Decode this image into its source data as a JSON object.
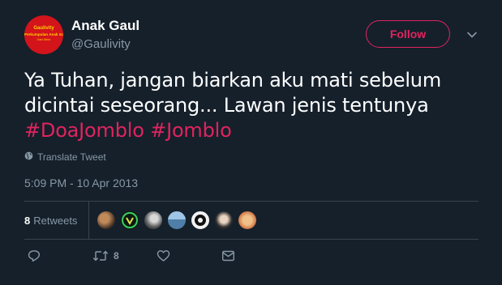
{
  "account": {
    "display_name": "Anak Gaul",
    "handle": "@Gaulivity",
    "avatar_text": {
      "line1": "Gaulivity",
      "line2": "Perkumpulan Anak Gaul",
      "line3": "Gaul Abizz"
    }
  },
  "follow_button": {
    "label": "Follow"
  },
  "tweet": {
    "line1": "Ya Tuhan, jangan biarkan aku mati sebelum",
    "line2": "dicintai seseorang... Lawan jenis tentunya",
    "hashtags": [
      "#DoaJomblo",
      "#Jomblo"
    ]
  },
  "translate": {
    "label": "Translate Tweet"
  },
  "timestamp": "5:09 PM - 10 Apr 2013",
  "stats": {
    "retweet_count": "8",
    "retweet_label": "Retweets"
  },
  "actions": {
    "reply": {
      "icon": "reply-icon"
    },
    "retweet": {
      "icon": "retweet-icon",
      "count": "8"
    },
    "like": {
      "icon": "heart-icon"
    },
    "dm": {
      "icon": "mail-icon"
    }
  },
  "colors": {
    "background": "#15202b",
    "accent": "#e0245e",
    "secondary_text": "#8899a6",
    "divider": "#38444d"
  }
}
